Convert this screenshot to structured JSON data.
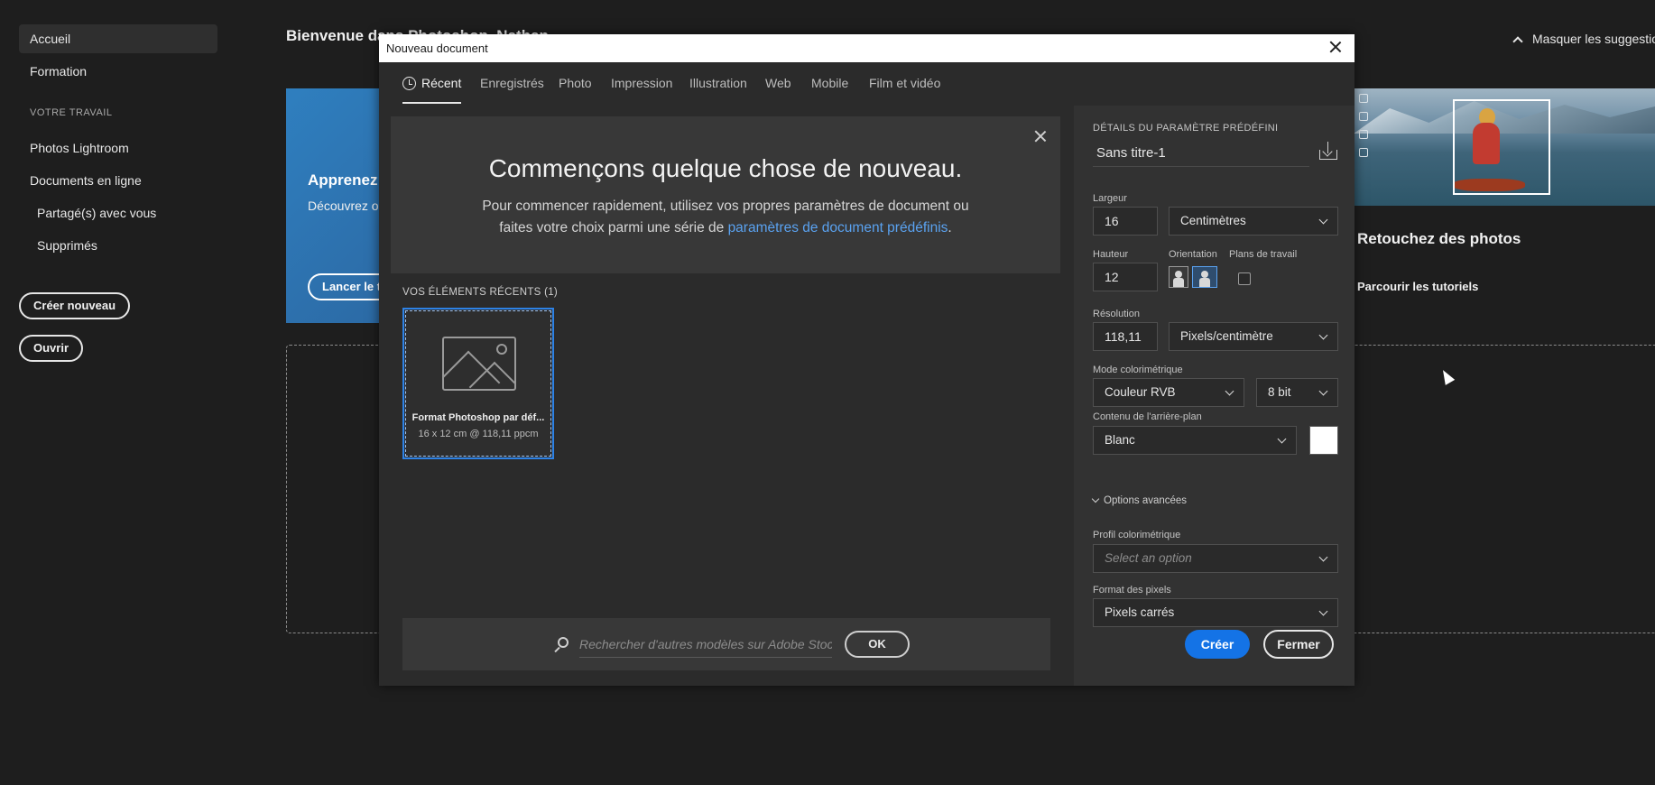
{
  "home": {
    "sidebar": {
      "items": [
        {
          "label": "Accueil"
        },
        {
          "label": "Formation"
        },
        {
          "label": "Photos Lightroom"
        },
        {
          "label": "Documents en ligne"
        },
        {
          "label": "Partagé(s) avec vous"
        },
        {
          "label": "Supprimés"
        }
      ],
      "section_label": "VOTRE TRAVAIL",
      "create_button": "Créer nouveau",
      "open_button": "Ouvrir"
    },
    "title": "Bienvenue dans Photoshop, Nathan",
    "hide_suggestions": "Masquer les suggestions",
    "learn_card": {
      "title": "Apprenez à",
      "text": "Découvrez où",
      "button": "Lancer le t"
    },
    "retouch_card": {
      "title": "Retouchez des photos",
      "link": "Parcourir les tutoriels"
    }
  },
  "dialog": {
    "title": "Nouveau document",
    "tabs": [
      {
        "label": "Récent"
      },
      {
        "label": "Enregistrés"
      },
      {
        "label": "Photo"
      },
      {
        "label": "Impression"
      },
      {
        "label": "Illustration"
      },
      {
        "label": "Web"
      },
      {
        "label": "Mobile"
      },
      {
        "label": "Film et vidéo"
      }
    ],
    "welcome": {
      "title": "Commençons quelque chose de nouveau.",
      "text_before": "Pour commencer rapidement, utilisez vos propres paramètres de document ou faites votre choix parmi une série de ",
      "link": "paramètres de document prédéfinis",
      "text_after": "."
    },
    "recent": {
      "label": "VOS ÉLÉMENTS RÉCENTS  (1)",
      "items": [
        {
          "name": "Format Photoshop par déf...",
          "meta": "16 x 12 cm @ 118,11 ppcm"
        }
      ]
    },
    "search": {
      "placeholder": "Rechercher d'autres modèles sur Adobe Stock",
      "ok": "OK"
    },
    "preset": {
      "heading": "DÉTAILS DU PARAMÈTRE PRÉDÉFINI",
      "name": "Sans titre-1",
      "width_label": "Largeur",
      "width_value": "16",
      "width_unit": "Centimètres",
      "height_label": "Hauteur",
      "height_value": "12",
      "orientation_label": "Orientation",
      "artboards_label": "Plans de travail",
      "resolution_label": "Résolution",
      "resolution_value": "118,11",
      "resolution_unit": "Pixels/centimètre",
      "color_mode_label": "Mode colorimétrique",
      "color_mode": "Couleur RVB",
      "bit_depth": "8 bit",
      "background_label": "Contenu de l'arrière-plan",
      "background": "Blanc",
      "background_color": "#ffffff",
      "advanced": "Options avancées",
      "profile_label": "Profil colorimétrique",
      "profile_placeholder": "Select an option",
      "pixel_format_label": "Format des pixels",
      "pixel_format": "Pixels carrés"
    },
    "create_button": "Créer",
    "close_button": "Fermer"
  }
}
